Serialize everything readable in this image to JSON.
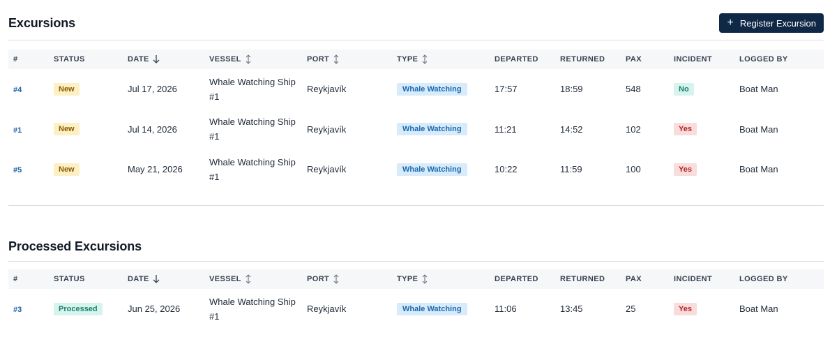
{
  "excursions": {
    "title": "Excursions",
    "register_button": {
      "icon": "plus-icon",
      "label": "Register Excursion"
    },
    "columns": [
      "#",
      "STATUS",
      "DATE",
      "VESSEL",
      "PORT",
      "TYPE",
      "DEPARTED",
      "RETURNED",
      "PAX",
      "INCIDENT",
      "LOGGED BY"
    ],
    "rows": [
      {
        "id": "#4",
        "status": "New",
        "date": "Jul 17, 2026",
        "vessel_line1": "Whale Watching Ship",
        "vessel_line2": "#1",
        "port": "Reykjavík",
        "type": "Whale Watching",
        "departed": "17:57",
        "returned": "18:59",
        "pax": "548",
        "incident": "No",
        "logged_by": "Boat Man"
      },
      {
        "id": "#1",
        "status": "New",
        "date": "Jul 14, 2026",
        "vessel_line1": "Whale Watching Ship",
        "vessel_line2": "#1",
        "port": "Reykjavík",
        "type": "Whale Watching",
        "departed": "11:21",
        "returned": "14:52",
        "pax": "102",
        "incident": "Yes",
        "logged_by": "Boat Man"
      },
      {
        "id": "#5",
        "status": "New",
        "date": "May 21, 2026",
        "vessel_line1": "Whale Watching Ship",
        "vessel_line2": "#1",
        "port": "Reykjavík",
        "type": "Whale Watching",
        "departed": "10:22",
        "returned": "11:59",
        "pax": "100",
        "incident": "Yes",
        "logged_by": "Boat Man"
      }
    ]
  },
  "processed": {
    "title": "Processed Excursions",
    "columns": [
      "#",
      "STATUS",
      "DATE",
      "VESSEL",
      "PORT",
      "TYPE",
      "DEPARTED",
      "RETURNED",
      "PAX",
      "INCIDENT",
      "LOGGED BY"
    ],
    "rows": [
      {
        "id": "#3",
        "status": "Processed",
        "date": "Jun 25, 2026",
        "vessel_line1": "Whale Watching Ship",
        "vessel_line2": "#1",
        "port": "Reykjavík",
        "type": "Whale Watching",
        "departed": "11:06",
        "returned": "13:45",
        "pax": "25",
        "incident": "Yes",
        "logged_by": "Boat Man"
      }
    ]
  },
  "sort": {
    "date": "descending",
    "vessel": "unsorted",
    "port": "unsorted",
    "type": "unsorted"
  },
  "colors": {
    "primary_button": "#0f2846",
    "link": "#1f5fa8",
    "new_badge_bg": "#fdf0c4",
    "processed_badge_bg": "#d7f3ee",
    "type_badge_bg": "#d8ebfa",
    "incident_yes_bg": "#f9dcdc",
    "incident_no_bg": "#d7f3ee"
  }
}
